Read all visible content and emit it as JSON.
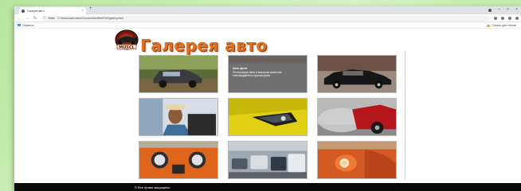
{
  "browser": {
    "tab_title": "Галерея авто",
    "tab_close": "×",
    "new_tab": "+",
    "url_prefix": "Файл",
    "url": "C:/Users/username/Documents/Web/ГАЛ/gallery.html",
    "bookmarks": [
      {
        "label": "Сервисы",
        "icon": "apps-icon"
      }
    ],
    "other_bookmarks": "Список для чтения"
  },
  "page": {
    "title": "Галерея авто",
    "logo_text": "MUSCL",
    "footer": "© Все права защищены."
  },
  "gallery": {
    "tiles": [
      {
        "id": "suv-forest",
        "kind": "photo"
      },
      {
        "id": "overlay",
        "kind": "overlay",
        "overlay_title": "Авто фото",
        "overlay_text": "Фотографии авто в высоком качестве. Наслаждайтесь просмотром!"
      },
      {
        "id": "black-classic",
        "kind": "photo"
      },
      {
        "id": "man-in-car",
        "kind": "photo"
      },
      {
        "id": "yellow-headlight",
        "kind": "photo"
      },
      {
        "id": "red-exhaust",
        "kind": "photo"
      },
      {
        "id": "orange-front",
        "kind": "photo"
      },
      {
        "id": "traffic",
        "kind": "photo"
      },
      {
        "id": "orange-beetle",
        "kind": "photo"
      }
    ]
  },
  "colors": {
    "accent": "#e06f1f",
    "footer_bg": "#0a0a0a",
    "frame": "#b6e69b"
  }
}
